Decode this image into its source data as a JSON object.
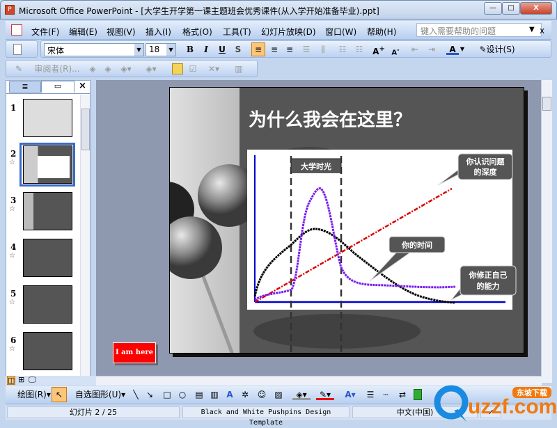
{
  "window": {
    "title": "Microsoft Office PowerPoint - [大学生开学第一课主题班会优秀课件(从入学开始准备毕业).ppt]",
    "minimize": "—",
    "maximize": "□",
    "close": "X"
  },
  "menu": {
    "items": [
      "文件(F)",
      "编辑(E)",
      "视图(V)",
      "插入(I)",
      "格式(O)",
      "工具(T)",
      "幻灯片放映(D)",
      "窗口(W)",
      "帮助(H)"
    ],
    "help_placeholder": "键入需要帮助的问题",
    "close": "x"
  },
  "formatting": {
    "font": "宋体",
    "size": "18",
    "bold": "B",
    "italic": "I",
    "underline": "U",
    "shadow": "S",
    "font_color": "A",
    "design": "设计(S)"
  },
  "reviewing": {
    "reviewer": "审阅者(R)..."
  },
  "panel": {
    "tabs": [
      "outline-tab",
      "slides-tab"
    ],
    "close": "×",
    "slides": [
      {
        "num": "1"
      },
      {
        "num": "2",
        "selected": true
      },
      {
        "num": "3"
      },
      {
        "num": "4"
      },
      {
        "num": "5"
      },
      {
        "num": "6"
      }
    ],
    "star": "☆"
  },
  "slide": {
    "title": "为什么我会在这里？",
    "period_label": "大学时光",
    "callouts": [
      "你认识问题的深度",
      "你的时间",
      "你修正自己的能力"
    ],
    "callout_lines": [
      [
        "你认识问题",
        "的深度"
      ],
      [
        "你的时间"
      ],
      [
        "你修正自己",
        "的能力"
      ]
    ],
    "colors": {
      "depth": "#e00000",
      "time": "#7a1cf0",
      "ability": "#000000",
      "axis": "#0000cc"
    }
  },
  "button_iamhere": "I am here",
  "drawing": {
    "draw": "绘图(R)",
    "autoshapes": "自选图形(U)"
  },
  "status": {
    "slide": "幻灯片 2 / 25",
    "template": "Black and White Pushpins Design Template",
    "language": "中文(中国)"
  },
  "watermark": {
    "text": "uzzf.com",
    "badge": "东坡下载"
  }
}
